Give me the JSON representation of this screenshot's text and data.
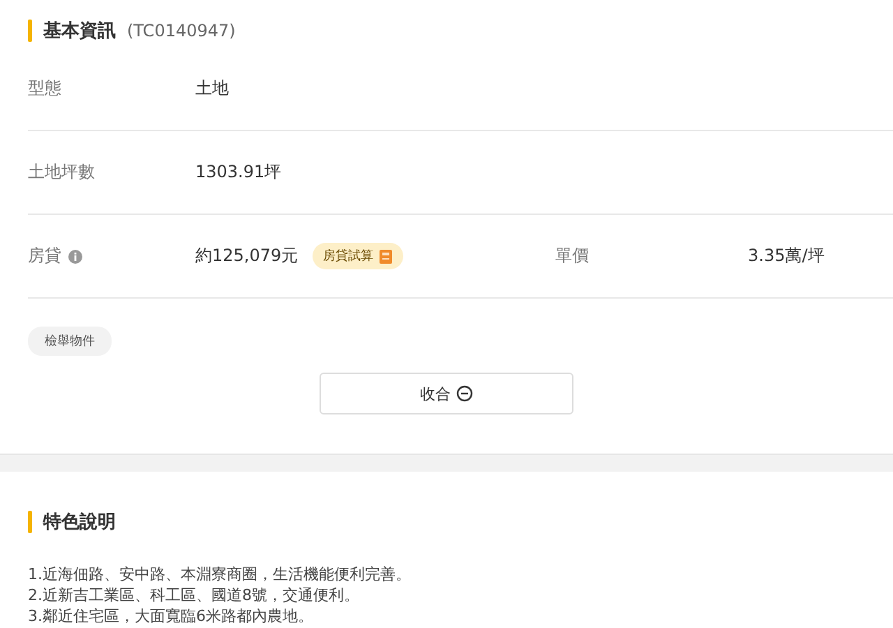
{
  "basic_info": {
    "title": "基本資訊",
    "code": "(TC0140947)",
    "rows": [
      {
        "label": "型態",
        "value": "土地"
      },
      {
        "label": "土地坪數",
        "value": "1303.91坪"
      },
      {
        "label": "房貸",
        "info": true,
        "value": "約125,079元",
        "badge": "房貸試算",
        "extra_label": "單價",
        "extra_value": "3.35萬/坪"
      }
    ],
    "report_button": "檢舉物件",
    "collapse_button": "收合"
  },
  "features": {
    "title": "特色說明",
    "lines": [
      "1.近海佃路、安中路、本淵寮商圈，生活機能便利完善。",
      "2.近新吉工業區、科工區、國道8號，交通便利。",
      "3.鄰近住宅區，大面寬臨6米路都內農地。"
    ]
  }
}
